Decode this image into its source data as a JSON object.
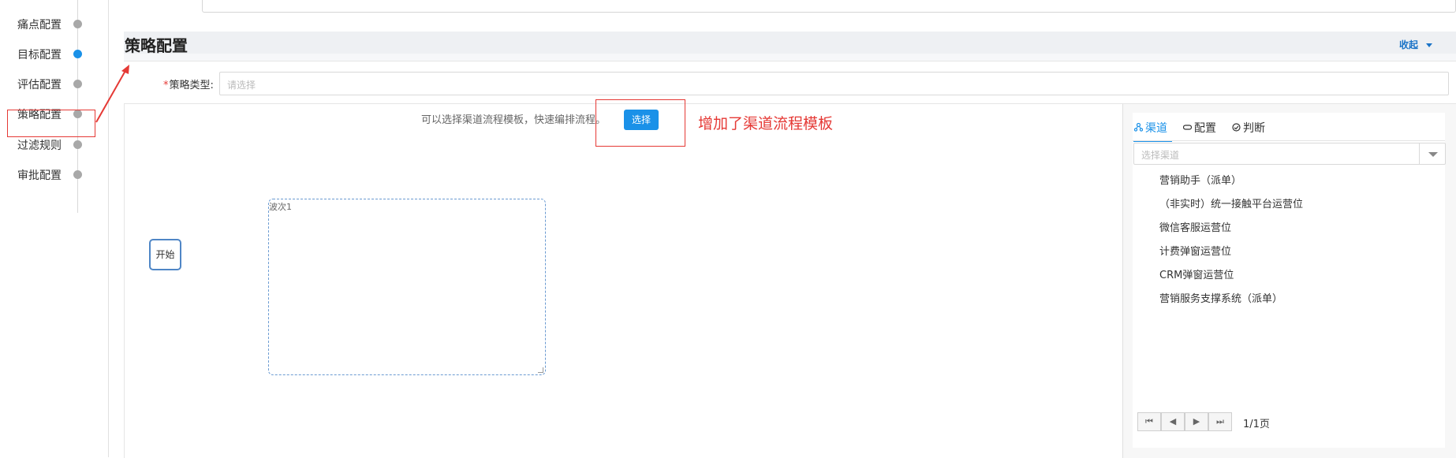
{
  "nav": {
    "items": [
      {
        "label": "痛点配置",
        "active": false
      },
      {
        "label": "目标配置",
        "active": true
      },
      {
        "label": "评估配置",
        "active": false
      },
      {
        "label": "策略配置",
        "active": false
      },
      {
        "label": "过滤规则",
        "active": false
      },
      {
        "label": "审批配置",
        "active": false
      }
    ]
  },
  "section": {
    "title": "策略配置",
    "collapse_label": "收起"
  },
  "strategy_type": {
    "required_mark": "*",
    "label": "策略类型:",
    "placeholder": "请选择"
  },
  "canvas": {
    "hint": "可以选择渠道流程模板，快速编排流程。",
    "select_button": "选择",
    "annotation": "增加了渠道流程模板",
    "start_node": "开始",
    "wave_label": "波次1"
  },
  "right_panel": {
    "tabs": [
      {
        "icon": "channel-icon",
        "label": "渠道",
        "active": true
      },
      {
        "icon": "config-loop-icon",
        "label": "配置",
        "active": false
      },
      {
        "icon": "judge-icon",
        "label": "判断",
        "active": false
      }
    ],
    "channel_select_placeholder": "选择渠道",
    "channels": [
      "营销助手（派单）",
      "（非实时）统一接触平台运营位",
      "微信客服运营位",
      "计费弹窗运营位",
      "CRM弹窗运营位",
      "营销服务支撑系统（派单）"
    ],
    "pager": {
      "page_info": "1/1页"
    }
  },
  "colors": {
    "accent": "#1a91e8",
    "annotation_red": "#e53935",
    "link_blue": "#1a73c7"
  }
}
